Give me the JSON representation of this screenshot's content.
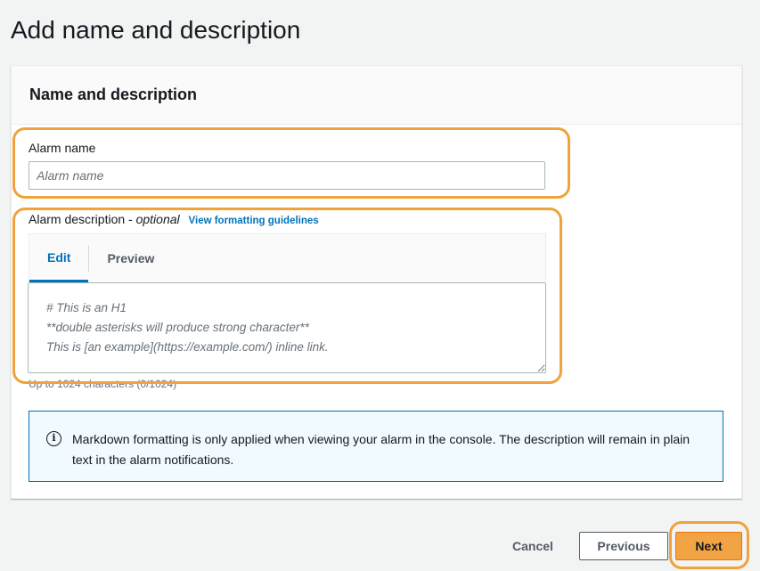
{
  "page": {
    "title": "Add name and description"
  },
  "panel": {
    "header": "Name and description",
    "alarm_name": {
      "label": "Alarm name",
      "placeholder": "Alarm name",
      "value": ""
    },
    "alarm_description": {
      "label": "Alarm description - ",
      "optional": "optional",
      "link": "View formatting guidelines",
      "tabs": [
        "Edit",
        "Preview"
      ],
      "active_tab": "Edit",
      "placeholder": "# This is an H1\n**double asterisks will produce strong character**\nThis is [an example](https://example.com/) inline link.",
      "value": "",
      "hint": "Up to 1024 characters (0/1024)"
    },
    "info": {
      "icon": "info-icon",
      "text": "Markdown formatting is only applied when viewing your alarm in the console. The description will remain in plain text in the alarm notifications."
    }
  },
  "footer": {
    "cancel": "Cancel",
    "previous": "Previous",
    "next": "Next"
  },
  "colors": {
    "highlight": "#f0a23d",
    "link": "#0073bb",
    "primary_button": "#f2a344",
    "info_background": "#f1faff"
  }
}
